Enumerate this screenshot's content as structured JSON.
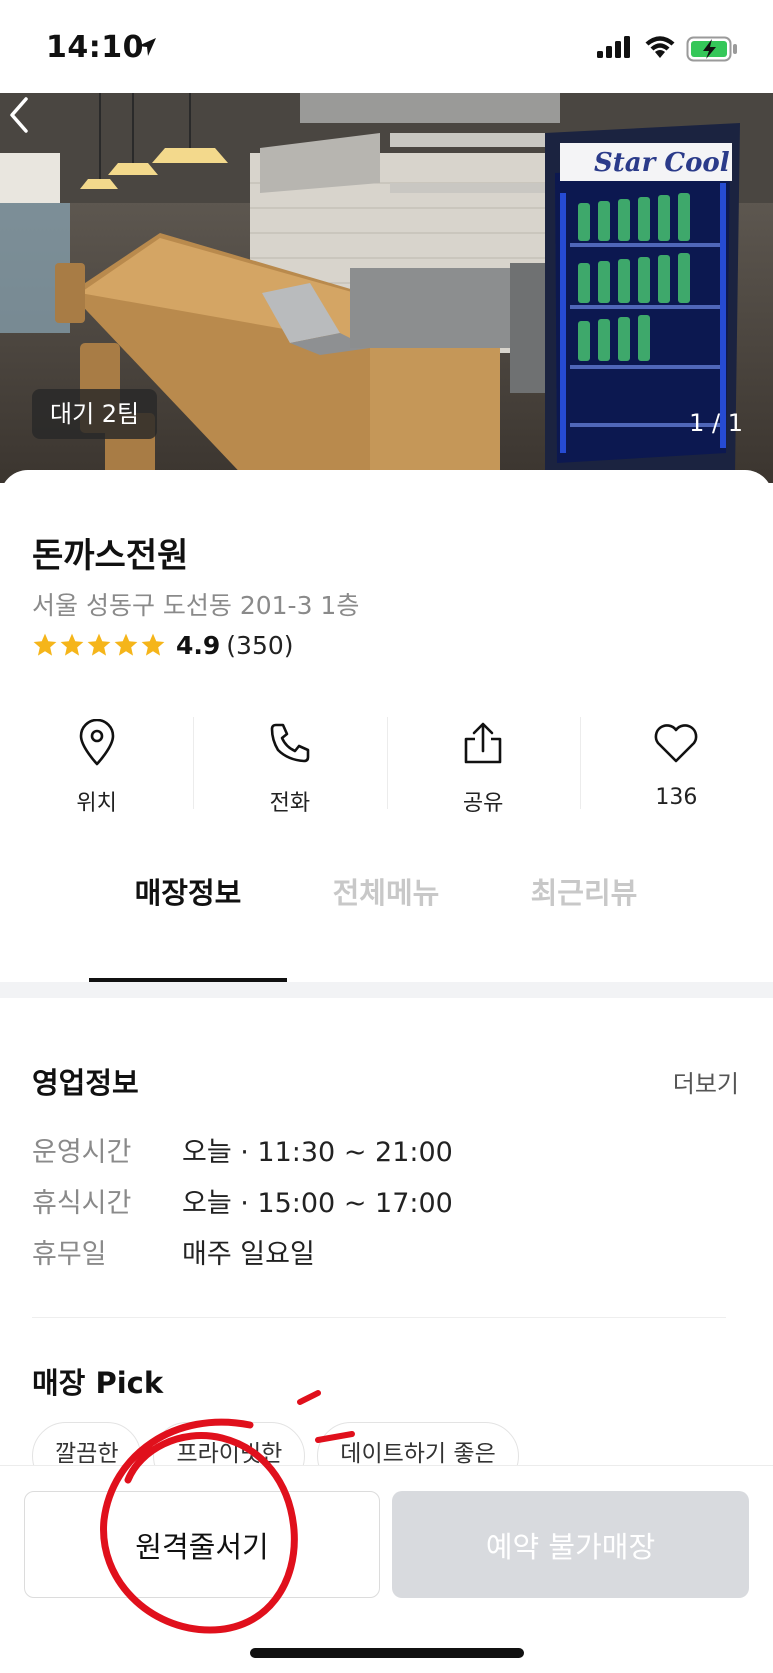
{
  "status_bar": {
    "time": "14:10"
  },
  "hero": {
    "wait_badge": "대기 2팀",
    "photo_counter": "1 / 1",
    "fridge_sign": "Star Cool"
  },
  "store": {
    "name": "돈까스전원",
    "address": "서울 성동구 도선동 201-3 1층",
    "rating": "4.9",
    "review_count": "(350)",
    "star_count": 5,
    "star_color": "#f5b51a"
  },
  "actions": [
    {
      "label": "위치",
      "icon": "location-pin-icon"
    },
    {
      "label": "전화",
      "icon": "phone-icon"
    },
    {
      "label": "공유",
      "icon": "share-icon"
    },
    {
      "label": "136",
      "icon": "heart-icon"
    }
  ],
  "tabs": [
    {
      "label": "매장정보",
      "active": true
    },
    {
      "label": "전체메뉴",
      "active": false
    },
    {
      "label": "최근리뷰",
      "active": false
    }
  ],
  "business_info": {
    "title": "영업정보",
    "more_label": "더보기",
    "rows": [
      {
        "label": "운영시간",
        "value": "오늘 · 11:30 ~ 21:00"
      },
      {
        "label": "휴식시간",
        "value": "오늘 · 15:00 ~ 17:00"
      },
      {
        "label": "휴무일",
        "value": "매주 일요일"
      }
    ]
  },
  "store_pick": {
    "title": "매장 Pick",
    "chips": [
      "깔끔한",
      "프라이빗한",
      "데이트하기 좋은"
    ]
  },
  "bottom_bar": {
    "queue_label": "원격줄서기",
    "reserve_label": "예약 불가매장"
  },
  "colors": {
    "annotation_red": "#e0101c",
    "disabled_button": "#d8dade",
    "fridge_led": "#2f5cff"
  }
}
